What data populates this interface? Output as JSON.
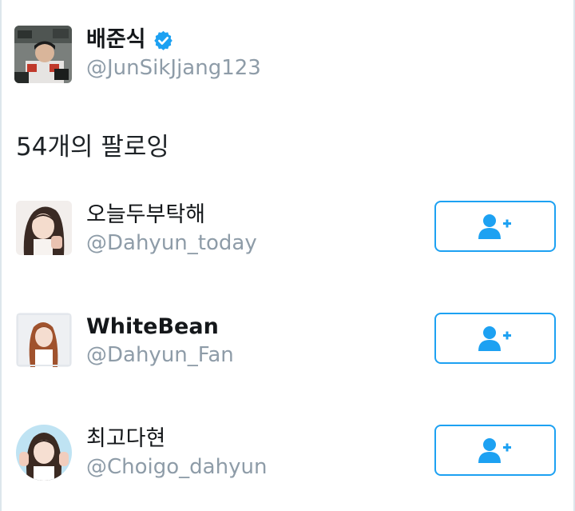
{
  "profile": {
    "name": "배준식",
    "handle": "@JunSikJjang123",
    "verified_icon": "verified-badge-icon"
  },
  "following": {
    "heading": "54개의 팔로잉"
  },
  "users": [
    {
      "name": "오늘두부탁해",
      "handle": "@Dahyun_today",
      "button_icon": "add-user-icon"
    },
    {
      "name": "WhiteBean",
      "handle": "@Dahyun_Fan",
      "button_icon": "add-user-icon"
    },
    {
      "name": "최고다현",
      "handle": "@Choigo_dahyun",
      "button_icon": "add-user-icon"
    }
  ],
  "colors": {
    "accent": "#1da1f2",
    "handle_gray": "#8e9ca8",
    "text_dark": "#14171a"
  }
}
